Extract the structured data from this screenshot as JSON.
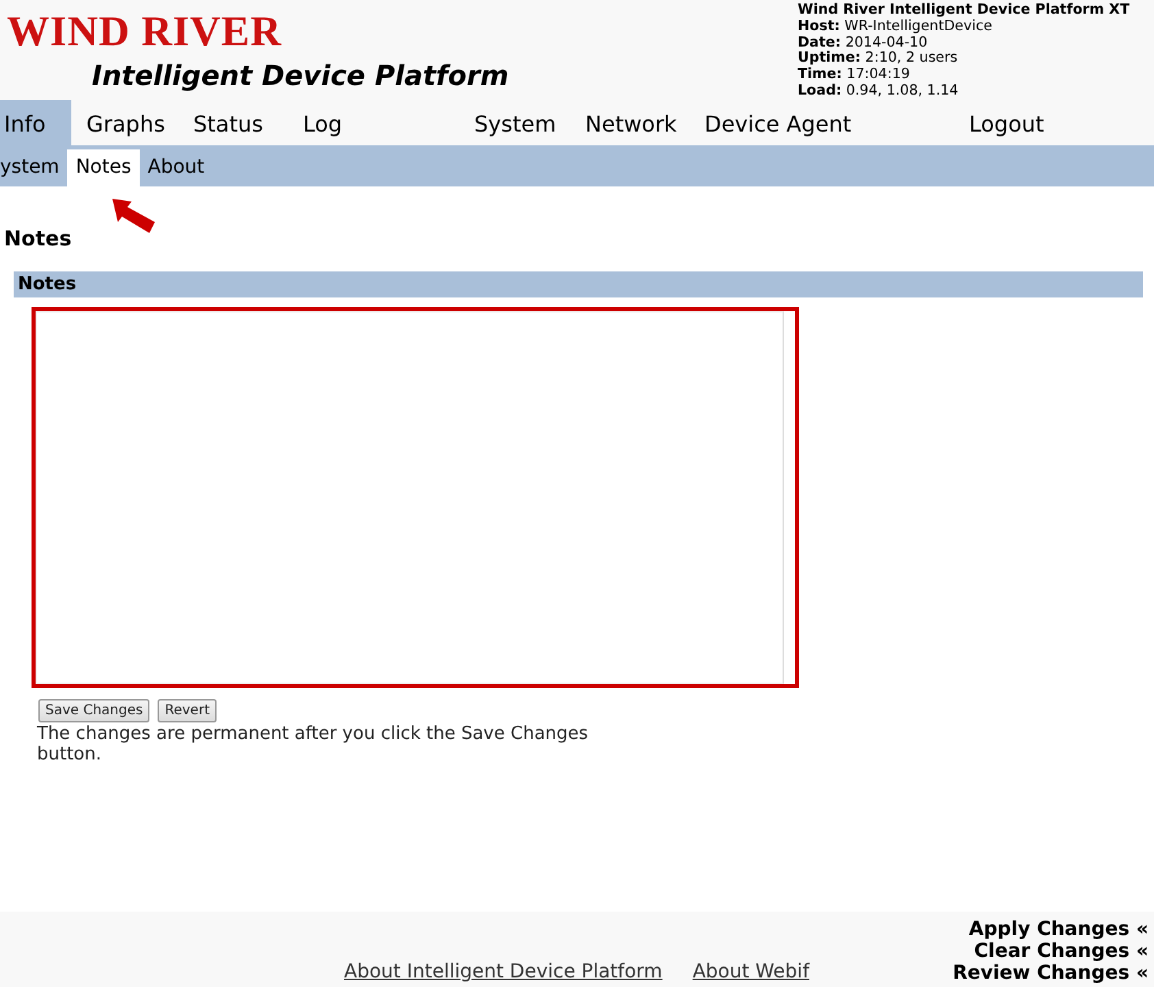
{
  "logo": {
    "brand": "WIND RIVER",
    "product": "Intelligent Device Platform"
  },
  "system_info": {
    "title": "Wind River Intelligent Device Platform XT",
    "fields": [
      {
        "label": "Host:",
        "value": "WR-IntelligentDevice"
      },
      {
        "label": "Date:",
        "value": "2014-04-10"
      },
      {
        "label": "Uptime:",
        "value": "2:10, 2 users"
      },
      {
        "label": "Time:",
        "value": "17:04:19"
      },
      {
        "label": "Load:",
        "value": "0.94, 1.08, 1.14"
      }
    ]
  },
  "main_nav": [
    {
      "label": "Info",
      "selected": true
    },
    {
      "label": "Graphs",
      "selected": false
    },
    {
      "label": "Status",
      "selected": false
    },
    {
      "label": "Log",
      "selected": false
    },
    {
      "label": "System",
      "selected": false
    },
    {
      "label": "Network",
      "selected": false
    },
    {
      "label": "Device Agent",
      "selected": false
    },
    {
      "label": "Logout",
      "selected": false
    }
  ],
  "sub_nav": [
    {
      "label": "ystem",
      "selected": false
    },
    {
      "label": "Notes",
      "selected": true
    },
    {
      "label": "About",
      "selected": false
    }
  ],
  "page_title": "Notes",
  "section": {
    "title": "Notes"
  },
  "buttons": [
    "Save Changes",
    "Revert"
  ],
  "help_text": "The changes are permanent after you click the Save Changes button.",
  "footer": {
    "links": [
      "About Intelligent Device Platform",
      "About Webif"
    ],
    "actions": [
      "Apply Changes «",
      "Clear Changes «",
      "Review Changes «"
    ]
  }
}
